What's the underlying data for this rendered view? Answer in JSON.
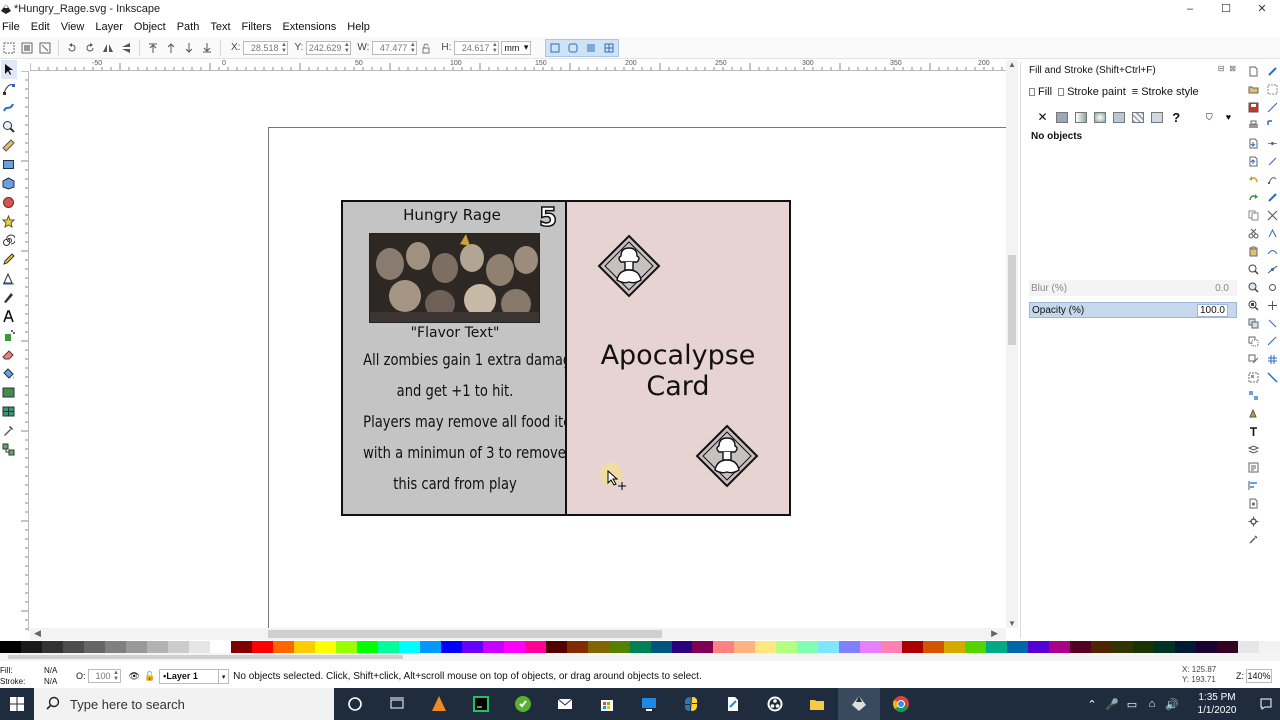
{
  "window": {
    "title": "*Hungry_Rage.svg - Inkscape",
    "controls": {
      "minimize": "–",
      "maximize": "☐",
      "close": "✕"
    }
  },
  "menu": [
    "File",
    "Edit",
    "View",
    "Layer",
    "Object",
    "Path",
    "Text",
    "Filters",
    "Extensions",
    "Help"
  ],
  "toolbar": {
    "x_label": "X:",
    "x_value": "28.518",
    "y_label": "Y:",
    "y_value": "242.629",
    "w_label": "W:",
    "w_value": "47.477",
    "h_label": "H:",
    "h_value": "24.617",
    "unit": "mm"
  },
  "rulers": {
    "h_labels": [
      "-50",
      "0",
      "50",
      "100",
      "150",
      "200",
      "250",
      "300",
      "350",
      "400",
      "450",
      "500",
      "550",
      "600",
      "650",
      "700",
      "750",
      "800",
      "850",
      "900",
      "950",
      "200"
    ],
    "v_labels": [
      "1",
      "0",
      "0",
      "0",
      "150",
      "200",
      "250",
      "300",
      "350",
      "400",
      "450",
      "500"
    ]
  },
  "card": {
    "title": "Hungry Rage",
    "cost": "5",
    "flavor": "\"Flavor Text\"",
    "rules": [
      "All zombies gain 1 extra damage",
      "and get +1 to hit.",
      "Players may remove all food items",
      "with a minimun of 3 to remove",
      "this card from play"
    ],
    "back_title": "Apocalypse Card"
  },
  "dock": {
    "title": "Fill and Stroke (Shift+Ctrl+F)",
    "tabs": [
      "Fill",
      "Stroke paint",
      "Stroke style"
    ],
    "no_objects": "No objects",
    "blur_label": "Blur (%)",
    "blur_value": "0.0",
    "opacity_label": "Opacity (%)",
    "opacity_value": "100.0",
    "unknown_paint": "?"
  },
  "status": {
    "fill_label": "Fill:",
    "fill_value": "N/A",
    "stroke_label": "Stroke:",
    "stroke_value": "N/A",
    "opacity_label": "O:",
    "opacity_value": "100",
    "layer": "•Layer 1",
    "message": "No objects selected. Click, Shift+click, Alt+scroll mouse on top of objects, or drag around objects to select.",
    "coord_x": "X: 125.87",
    "coord_y": "Y: 193.71",
    "zoom_label": "Z:",
    "zoom_value": "140%"
  },
  "taskbar": {
    "search_placeholder": "Type here to search",
    "time": "1:35 PM",
    "date": "1/1/2020"
  },
  "palette_colors": [
    "#000000",
    "#1a1a1a",
    "#333333",
    "#4d4d4d",
    "#666666",
    "#808080",
    "#999999",
    "#b3b3b3",
    "#cccccc",
    "#e6e6e6",
    "#ffffff",
    "#800000",
    "#ff0000",
    "#ff6600",
    "#ffcc00",
    "#ffff00",
    "#99ff00",
    "#00ff00",
    "#00ff99",
    "#00ffff",
    "#0099ff",
    "#0000ff",
    "#6600ff",
    "#cc00ff",
    "#ff00ff",
    "#ff0099",
    "#550000",
    "#802b00",
    "#806600",
    "#558000",
    "#008055",
    "#005580",
    "#2b0080",
    "#800055",
    "#ff8080",
    "#ffb380",
    "#ffe680",
    "#b3ff80",
    "#80ffb3",
    "#80e6ff",
    "#8080ff",
    "#e680ff",
    "#ff80b3",
    "#aa0000",
    "#d45500",
    "#d4aa00",
    "#55d400",
    "#00aa88",
    "#0066aa",
    "#5500d4",
    "#aa0088",
    "#550022",
    "#4d2600",
    "#333300",
    "#1a3300",
    "#003322",
    "#001a33",
    "#1a0033",
    "#330022",
    "#e6e6e6",
    "#f2f2f2"
  ],
  "colors": {
    "card_left_bg": "#c4c4c4",
    "card_right_bg": "#e7d3d1",
    "taskbar_bg": "#1f2c3d",
    "opacity_highlight": "#c5d8ec"
  }
}
